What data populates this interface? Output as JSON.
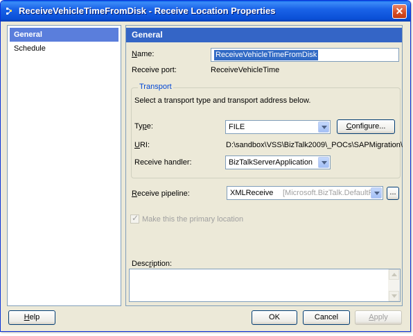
{
  "window": {
    "title": "ReceiveVehicleTimeFromDisk - Receive Location Properties",
    "close_label": "✕"
  },
  "nav": {
    "items": [
      {
        "label": "General",
        "selected": true
      },
      {
        "label": "Schedule",
        "selected": false
      }
    ]
  },
  "panel": {
    "header": "General",
    "name_label": "Name:",
    "name_value": "ReceiveVehicleTimeFromDisk",
    "receive_port_label": "Receive port:",
    "receive_port_value": "ReceiveVehicleTime",
    "transport": {
      "title": "Transport",
      "instructions": "Select a transport type and transport address below.",
      "type_label": "Type:",
      "type_value": "FILE",
      "configure_label": "Configure...",
      "uri_label": "URI:",
      "uri_value": "D:\\sandbox\\VSS\\BizTalk2009\\_POCs\\SAPMigration\\",
      "handler_label": "Receive handler:",
      "handler_value": "BizTalkServerApplication"
    },
    "pipeline_label": "Receive pipeline:",
    "pipeline_name": "XMLReceive",
    "pipeline_assembly": "[Microsoft.BizTalk.DefaultPip",
    "pipeline_browse_label": "...",
    "primary_label": "Make this the primary location",
    "description_label": "Description:",
    "description_value": ""
  },
  "buttons": {
    "help": "Help",
    "ok": "OK",
    "cancel": "Cancel",
    "apply": "Apply"
  },
  "colors": {
    "titlebar": "#0a4fd6",
    "selection": "#5a7edc",
    "header": "#3465c6",
    "group_title": "#0046d5"
  }
}
